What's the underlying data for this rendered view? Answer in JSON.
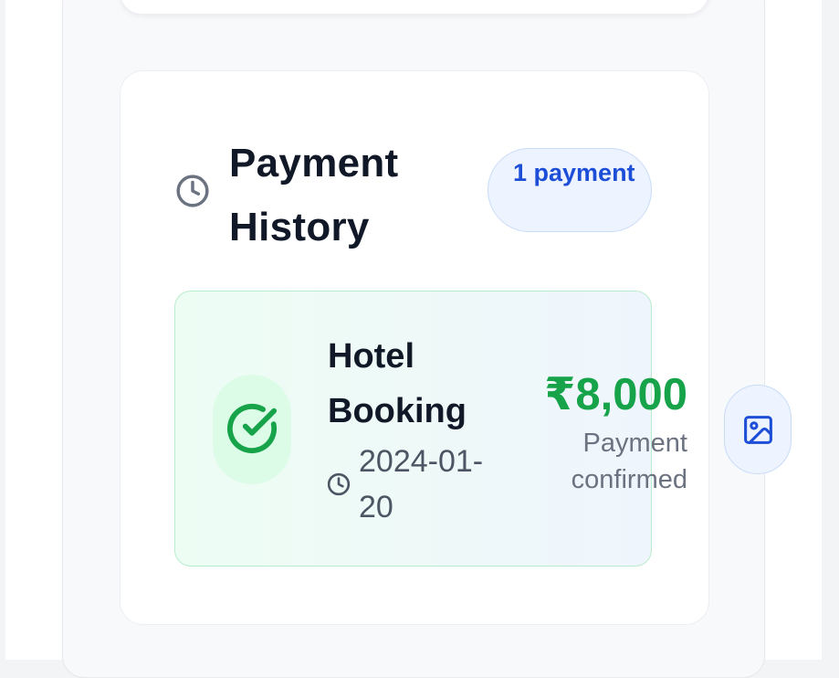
{
  "payment_history": {
    "title": "Payment History",
    "badge": "1 payment",
    "items": [
      {
        "title": "Hotel Booking",
        "date": "2024-01-20",
        "amount": "₹8,000",
        "status_line1": "Payment",
        "status_line2": "confirmed"
      }
    ]
  },
  "icons": {
    "header": "clock-icon",
    "status": "check-circle-icon",
    "date": "clock-icon",
    "action": "image-icon"
  },
  "colors": {
    "success": "#16a34a",
    "accent": "#1d4ed8",
    "title": "#111827",
    "muted": "#6b7280"
  }
}
